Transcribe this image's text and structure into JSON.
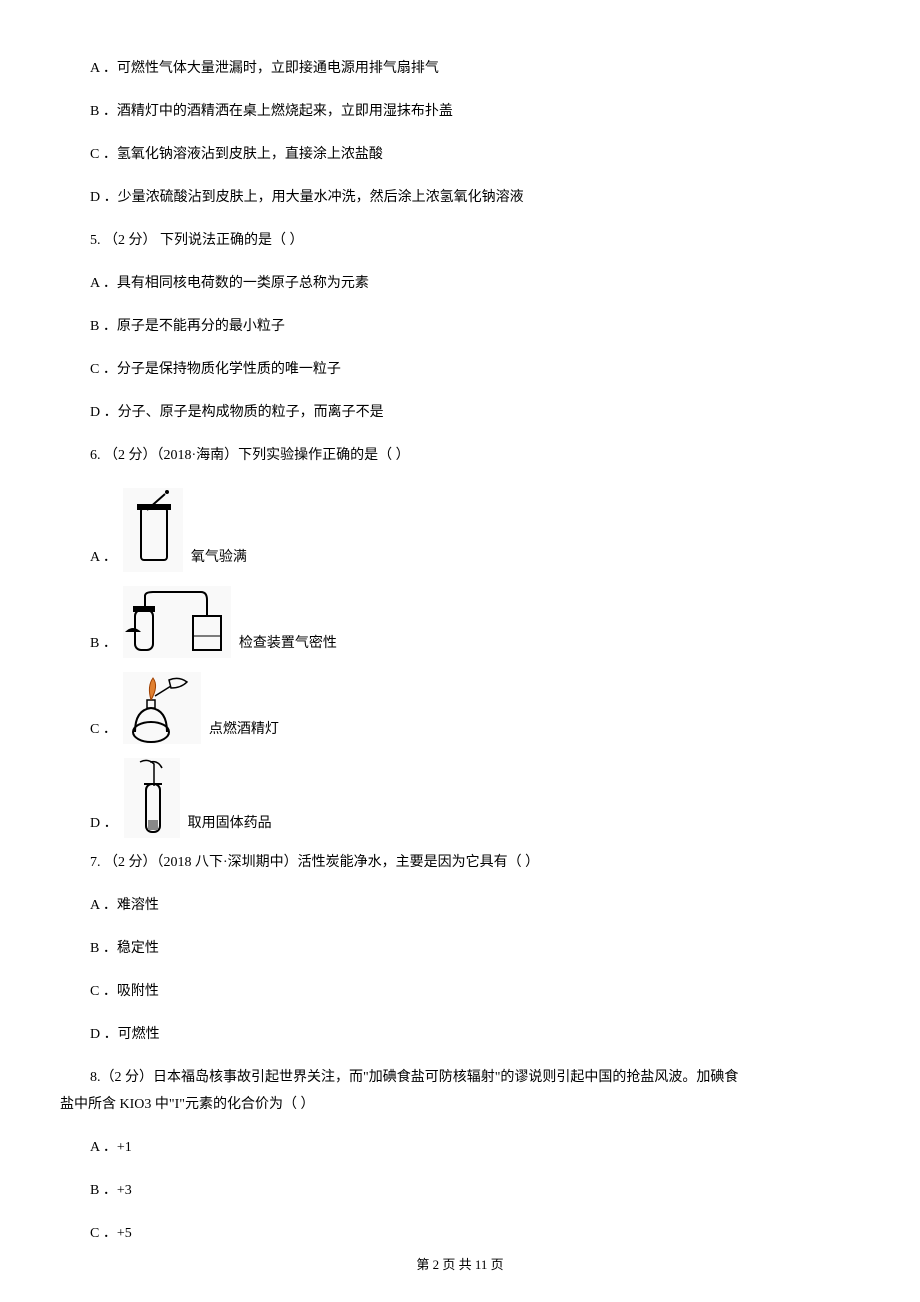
{
  "q4": {
    "A": "A ．可燃性气体大量泄漏时，立即接通电源用排气扇排气",
    "B": "B ．酒精灯中的酒精洒在桌上燃烧起来，立即用湿抹布扑盖",
    "C": "C ．氢氧化钠溶液沾到皮肤上，直接涂上浓盐酸",
    "D": "D ．少量浓硫酸沾到皮肤上，用大量水冲洗，然后涂上浓氢氧化钠溶液"
  },
  "q5": {
    "stem": "5. （2 分） 下列说法正确的是（    ）",
    "A": "A ．具有相同核电荷数的一类原子总称为元素",
    "B": "B ．原子是不能再分的最小粒子",
    "C": "C ．分子是保持物质化学性质的唯一粒子",
    "D": "D ．分子、原子是构成物质的粒子，而离子不是"
  },
  "q6": {
    "stem": "6. （2 分）（2018·海南）下列实验操作正确的是（    ）",
    "A": {
      "letter": "A ．",
      "label": "氧气验满"
    },
    "B": {
      "letter": "B ．",
      "label": "检查装置气密性"
    },
    "C": {
      "letter": "C ．",
      "label": "点燃酒精灯"
    },
    "D": {
      "letter": "D ．",
      "label": "取用固体药品"
    }
  },
  "q7": {
    "stem": "7. （2 分）（2018 八下·深圳期中）活性炭能净水，主要是因为它具有（    ）",
    "A": "A ．难溶性",
    "B": "B ．稳定性",
    "C": "C ．吸附性",
    "D": "D ．可燃性"
  },
  "q8": {
    "stem1": "8.（2 分）日本福岛核事故引起世界关注，而\"加碘食盐可防核辐射\"的谬说则引起中国的抢盐风波。加碘食",
    "stem2": "盐中所含 KIO3 中\"I\"元素的化合价为（    ）",
    "A": "A ．+1",
    "B": "B ．+3",
    "C": "C ．+5"
  },
  "footer": "第 2 页 共 11 页"
}
